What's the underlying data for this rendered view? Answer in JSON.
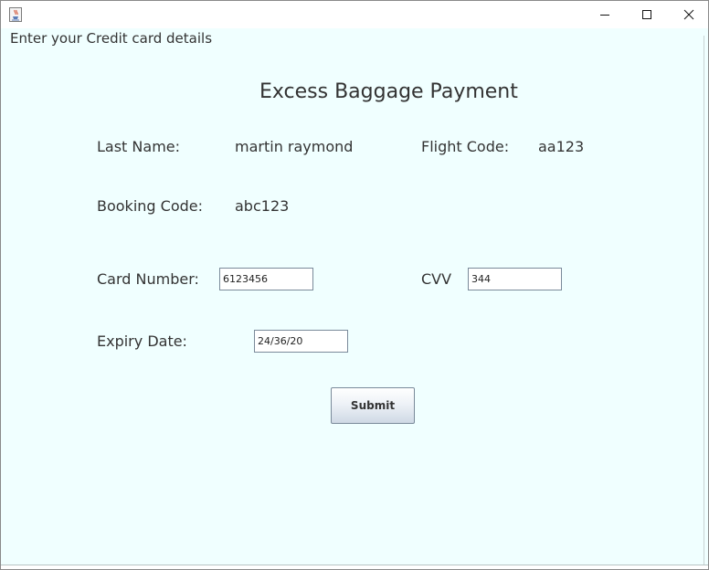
{
  "window": {
    "app_icon": "java-cup-icon",
    "controls": {
      "minimize": "minimize-icon",
      "maximize": "maximize-icon",
      "close": "close-icon"
    }
  },
  "header": {
    "text": "Enter your Credit card details"
  },
  "form": {
    "title": "Excess Baggage Payment",
    "last_name_label": "Last Name:",
    "last_name_value": "martin raymond",
    "flight_code_label": "Flight Code:",
    "flight_code_value": "aa123",
    "booking_code_label": "Booking Code:",
    "booking_code_value": "abc123",
    "card_number_label": "Card Number:",
    "card_number_value": "6123456",
    "cvv_label": "CVV",
    "cvv_value": "344",
    "expiry_label": "Expiry Date:",
    "expiry_value": "24/36/20",
    "submit_label": "Submit"
  },
  "colors": {
    "background": "#f0ffff",
    "text": "#333333"
  }
}
